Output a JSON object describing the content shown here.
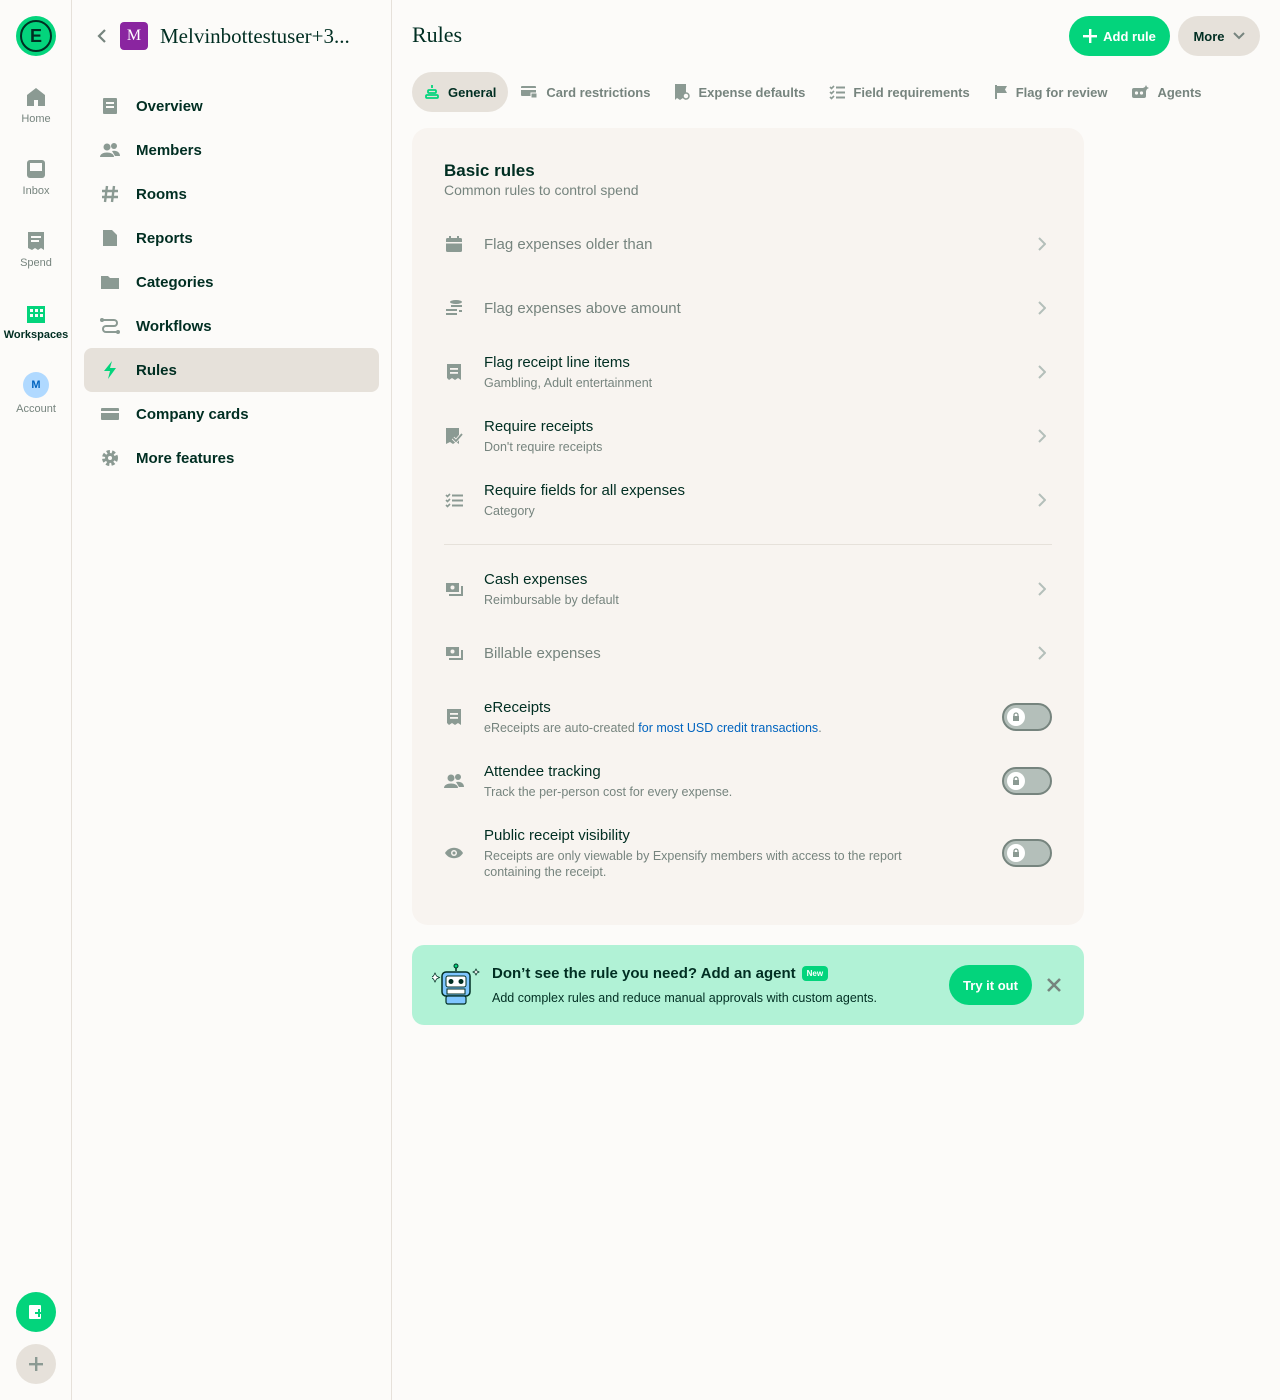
{
  "rail": {
    "items": [
      {
        "label": "Home",
        "icon": "home-icon"
      },
      {
        "label": "Inbox",
        "icon": "inbox-icon"
      },
      {
        "label": "Spend",
        "icon": "receipt-icon"
      },
      {
        "label": "Workspaces",
        "icon": "building-icon"
      },
      {
        "label": "Account",
        "avatar": "M"
      }
    ]
  },
  "sidebar": {
    "workspace_initial": "M",
    "workspace_name": "Melvinbottestuser+3...",
    "items": [
      {
        "label": "Overview"
      },
      {
        "label": "Members"
      },
      {
        "label": "Rooms"
      },
      {
        "label": "Reports"
      },
      {
        "label": "Categories"
      },
      {
        "label": "Workflows"
      },
      {
        "label": "Rules"
      },
      {
        "label": "Company cards"
      },
      {
        "label": "More features"
      }
    ]
  },
  "header": {
    "title": "Rules",
    "add_label": "Add rule",
    "more_label": "More"
  },
  "tabs": [
    {
      "label": "General"
    },
    {
      "label": "Card restrictions"
    },
    {
      "label": "Expense defaults"
    },
    {
      "label": "Field requirements"
    },
    {
      "label": "Flag for review"
    },
    {
      "label": "Agents"
    }
  ],
  "card": {
    "title": "Basic rules",
    "subtitle": "Common rules to control spend",
    "rows": [
      {
        "title": "Flag expenses older than",
        "subtitle": ""
      },
      {
        "title": "Flag expenses above amount",
        "subtitle": ""
      },
      {
        "title": "Flag receipt line items",
        "subtitle": "Gambling, Adult entertainment"
      },
      {
        "title": "Require receipts",
        "subtitle": "Don't require receipts"
      },
      {
        "title": "Require fields for all expenses",
        "subtitle": "Category"
      },
      {
        "title": "Cash expenses",
        "subtitle": "Reimbursable by default"
      },
      {
        "title": "Billable expenses",
        "subtitle": ""
      },
      {
        "title": "eReceipts",
        "subtitle": "eReceipts are auto-created ",
        "link": "for most USD credit transactions",
        "subtitle_end": "."
      },
      {
        "title": "Attendee tracking",
        "subtitle": "Track the per-person cost for every expense."
      },
      {
        "title": "Public receipt visibility",
        "subtitle": "Receipts are only viewable by Expensify members with access to the report containing the receipt."
      }
    ]
  },
  "banner": {
    "title": "Don’t see the rule you need? Add an agent",
    "badge": "New",
    "subtitle": "Add complex rules and reduce manual approvals with custom agents.",
    "try_label": "Try it out"
  },
  "colors": {
    "brand_green": "#03d47c",
    "text_dark": "#002e22",
    "text_muted": "#76847e",
    "link": "#0164bf",
    "banner_bg": "#b1f2d6",
    "card_bg": "#f8f4f0"
  }
}
